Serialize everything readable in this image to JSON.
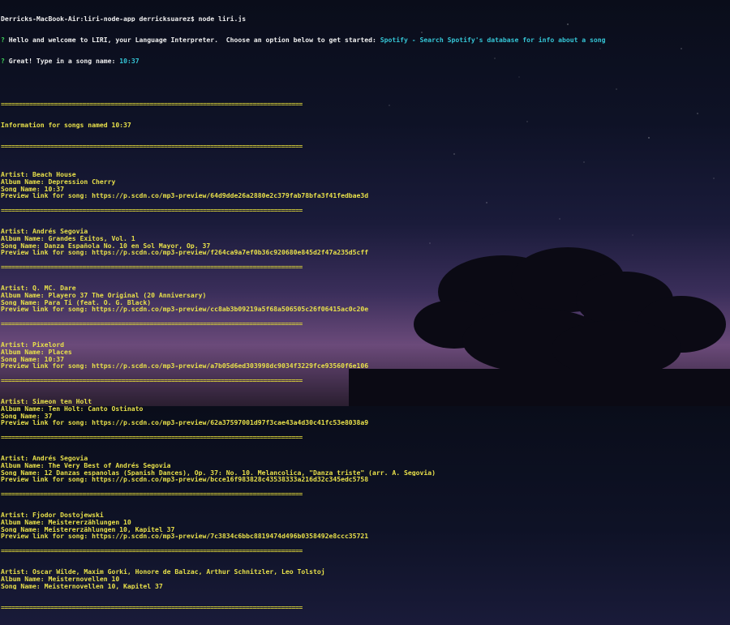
{
  "colors": {
    "text_yellow": "#e8e04a",
    "text_white": "#f0f0f0",
    "prompt_green": "#3fd15a",
    "answer_cyan": "#35c6d6"
  },
  "terminal": {
    "command_prompt": "Derricks-MacBook-Air:liri-node-app derricksuarez$ node liri.js",
    "q_mark": "?",
    "welcome": " Hello and welcome to LIRI, your Language Interpreter.  Choose an option below to get started: ",
    "welcome_choice": "Spotify - Search Spotify's database for info about a song",
    "song_prompt": " Great! Type in a song name: ",
    "song_answer": "10:37",
    "separator": "=====================================================================================",
    "header": "Information for songs named 10:37",
    "results": [
      {
        "artist": "Artist: Beach House",
        "album": "Album Name: Depression Cherry",
        "song": "Song Name: 10:37",
        "preview": "Preview link for song: https://p.scdn.co/mp3-preview/64d9dde26a2880e2c379fab78bfa3f41fedbae3d"
      },
      {
        "artist": "Artist: Andrés Segovia",
        "album": "Album Name: Grandes Éxitos, Vol. 1",
        "song": "Song Name: Danza Española No. 10 en Sol Mayor, Op. 37",
        "preview": "Preview link for song: https://p.scdn.co/mp3-preview/f264ca9a7ef0b36c920680e845d2f47a235d5cff"
      },
      {
        "artist": "Artist: Q. MC. Dare",
        "album": "Album Name: Playero 37 The Original (20 Anniversary)",
        "song": "Song Name: Para Ti (feat. O. G. Black)",
        "preview": "Preview link for song: https://p.scdn.co/mp3-preview/cc8ab3b09219a5f68a506505c26f06415ac0c20e"
      },
      {
        "artist": "Artist: Pixelord",
        "album": "Album Name: Places",
        "song": "Song Name: 10:37",
        "preview": "Preview link for song: https://p.scdn.co/mp3-preview/a7b05d6ed303998dc9034f3229fce93560f6e106"
      },
      {
        "artist": "Artist: Simeon ten Holt",
        "album": "Album Name: Ten Holt: Canto Ostinato",
        "song": "Song Name: 37",
        "preview": "Preview link for song: https://p.scdn.co/mp3-preview/62a37597001d97f3cae43a4d30c41fc53e8038a9"
      },
      {
        "artist": "Artist: Andrés Segovia",
        "album": "Album Name: The Very Best of Andrés Segovia",
        "song": "Song Name: 12 Danzas espanolas (Spanish Dances), Op. 37: No. 10. Melancolica, \"Danza triste\" (arr. A. Segovia)",
        "preview": "Preview link for song: https://p.scdn.co/mp3-preview/bcce16f983828c43538333a216d32c345edc5758"
      },
      {
        "artist": "Artist: Fjodor Dostojewski",
        "album": "Album Name: Meistererzählungen 10",
        "song": "Song Name: Meistererzählungen 10, Kapitel 37",
        "preview": "Preview link for song: https://p.scdn.co/mp3-preview/7c3834c6bbc8819474d496b0358492e8ccc35721"
      },
      {
        "artist": "Artist: Oscar Wilde, Maxim Gorki, Honore de Balzac, Arthur Schnitzler, Leo Tolstoj",
        "album": "Album Name: Meisternovellen 10",
        "song": "Song Name: Meisternovellen 10, Kapitel 37",
        "preview": ""
      }
    ]
  }
}
